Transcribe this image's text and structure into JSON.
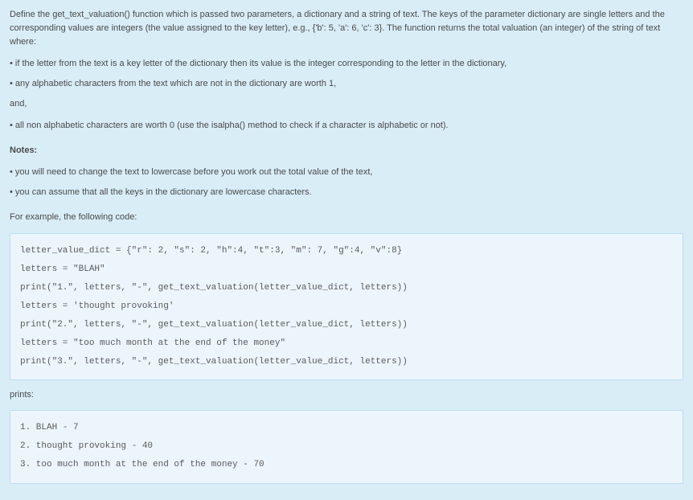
{
  "intro": "Define the get_text_valuation() function which is passed two parameters, a dictionary and a string of text.  The keys of the parameter dictionary are single letters and the corresponding values are integers (the value assigned to the key letter), e.g., {'b': 5, 'a': 6, 'c': 3}.  The function returns the total valuation (an integer) of the string of text where:",
  "rule1": "if the letter from the text is a key letter of the dictionary then its value is the integer corresponding to the letter in the dictionary,",
  "rule2": "any alphabetic characters from the text which are not in the dictionary are worth 1,",
  "and": "and,",
  "rule3": "all non alphabetic characters are worth 0 (use the isalpha() method to check if a character is alphabetic or not).",
  "notes_label": "Notes:",
  "note1": "you will need to change the text to lowercase before you work out the total value of the text,",
  "note2": "you can assume that all the keys in the dictionary are lowercase characters.",
  "example_intro": "For example, the following code:",
  "code_example": "letter_value_dict = {\"r\": 2, \"s\": 2, \"h\":4, \"t\":3, \"m\": 7, \"g\":4, \"v\":8}\nletters = \"BLAH\"\nprint(\"1.\", letters, \"-\", get_text_valuation(letter_value_dict, letters))\nletters = 'thought provoking'\nprint(\"2.\", letters, \"-\", get_text_valuation(letter_value_dict, letters))\nletters = \"too much month at the end of the money\"\nprint(\"3.\", letters, \"-\", get_text_valuation(letter_value_dict, letters))",
  "prints_label": "prints:",
  "output_example": "1. BLAH - 7\n2. thought provoking - 40\n3. too much month at the end of the money - 70"
}
